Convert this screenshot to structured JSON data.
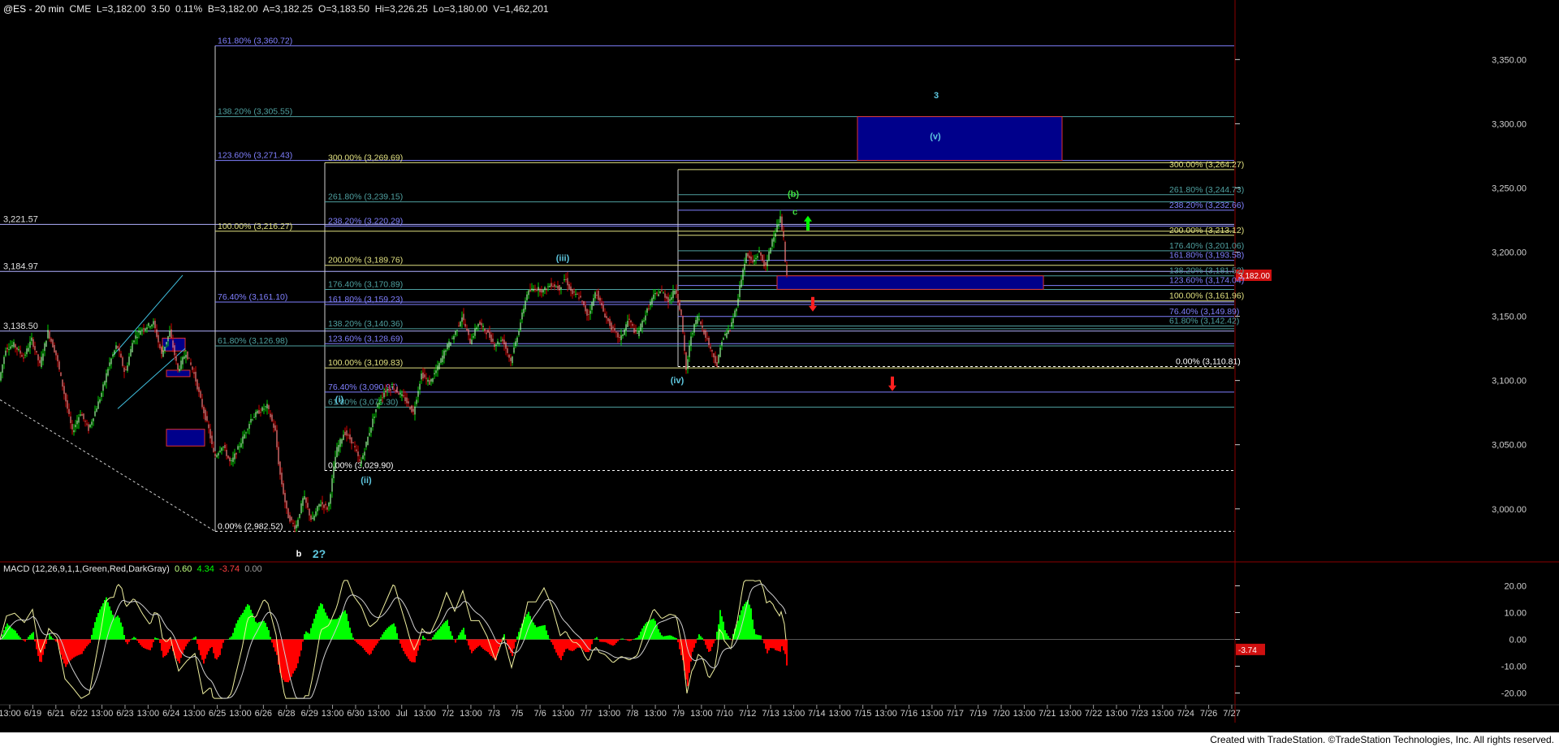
{
  "header": {
    "symbol": "@ES - 20 min",
    "exchange": "CME",
    "last": "L=3,182.00",
    "change": "3.50",
    "change_pct": "0.11%",
    "bid": "B=3,182.00",
    "ask": "A=3,182.25",
    "open": "O=3,183.50",
    "high": "Hi=3,226.25",
    "low": "Lo=3,180.00",
    "volume": "V=1,462,201"
  },
  "macd_header": {
    "title": "MACD (12,26,9,1,1,Green,Red,DarkGray)",
    "v1": "0.60",
    "v2": "4.34",
    "v3": "-3.74",
    "v4": "0.00"
  },
  "footer": "Created with TradeStation. ©TradeStation Technologies, Inc. All rights reserved.",
  "colors": {
    "background": "#000000",
    "price_axis_border": "#8b0000",
    "fib_blue": "#8080ff",
    "fib_teal": "#4fa0a0",
    "fib_yellow": "#e0e080",
    "target_box": "#00008b",
    "wave_label": "#5fc8e0",
    "up_arrow": "#00ff00",
    "down_arrow": "#ff2020",
    "macd_up": "#00ff00",
    "macd_down": "#ff0000"
  },
  "chart_data": {
    "type": "candlestick",
    "title": "@ES - 20 min",
    "ylim": [
      2960,
      3385
    ],
    "y_ticks": [
      "3,350.00",
      "3,300.00",
      "3,250.00",
      "3,200.00",
      "3,150.00",
      "3,100.00",
      "3,050.00",
      "3,000.00"
    ],
    "y_tick_values": [
      3350,
      3300,
      3250,
      3200,
      3150,
      3100,
      3050,
      3000
    ],
    "last_price_tag": "3,182.00",
    "last_price": 3182,
    "x_labels": [
      "13:00",
      "6/19",
      "6/21",
      "6/22",
      "13:00",
      "6/23",
      "13:00",
      "6/24",
      "13:00",
      "6/25",
      "13:00",
      "6/26",
      "6/28",
      "6/29",
      "13:00",
      "6/30",
      "13:00",
      "Jul",
      "13:00",
      "7/2",
      "13:00",
      "7/3",
      "7/5",
      "7/6",
      "13:00",
      "7/7",
      "13:00",
      "7/8",
      "13:00",
      "7/9",
      "13:00",
      "7/10",
      "7/12",
      "7/13",
      "13:00",
      "7/14",
      "13:00",
      "7/15",
      "13:00",
      "7/16",
      "13:00",
      "7/17",
      "7/19",
      "7/20",
      "13:00",
      "7/21",
      "13:00",
      "7/22",
      "13:00",
      "7/23",
      "13:00",
      "7/24",
      "7/26",
      "7/27"
    ],
    "price_path": [
      [
        0,
        3100
      ],
      [
        8,
        3125
      ],
      [
        18,
        3128
      ],
      [
        30,
        3118
      ],
      [
        40,
        3132
      ],
      [
        50,
        3112
      ],
      [
        60,
        3138
      ],
      [
        70,
        3120
      ],
      [
        80,
        3090
      ],
      [
        90,
        3060
      ],
      [
        100,
        3075
      ],
      [
        110,
        3062
      ],
      [
        125,
        3088
      ],
      [
        135,
        3112
      ],
      [
        145,
        3128
      ],
      [
        155,
        3105
      ],
      [
        165,
        3132
      ],
      [
        175,
        3140
      ],
      [
        190,
        3145
      ],
      [
        200,
        3120
      ],
      [
        210,
        3138
      ],
      [
        220,
        3108
      ],
      [
        230,
        3122
      ],
      [
        240,
        3105
      ],
      [
        250,
        3080
      ],
      [
        258,
        3062
      ],
      [
        265,
        3040
      ],
      [
        275,
        3050
      ],
      [
        285,
        3035
      ],
      [
        300,
        3055
      ],
      [
        310,
        3070
      ],
      [
        318,
        3075
      ],
      [
        330,
        3080
      ],
      [
        340,
        3060
      ],
      [
        345,
        3030
      ],
      [
        355,
        2995
      ],
      [
        365,
        2985
      ],
      [
        375,
        3010
      ],
      [
        385,
        2990
      ],
      [
        395,
        3005
      ],
      [
        405,
        3000
      ],
      [
        415,
        3045
      ],
      [
        425,
        3060
      ],
      [
        435,
        3052
      ],
      [
        445,
        3035
      ],
      [
        455,
        3058
      ],
      [
        465,
        3080
      ],
      [
        475,
        3092
      ],
      [
        485,
        3095
      ],
      [
        500,
        3085
      ],
      [
        510,
        3075
      ],
      [
        520,
        3105
      ],
      [
        530,
        3098
      ],
      [
        540,
        3110
      ],
      [
        550,
        3125
      ],
      [
        560,
        3135
      ],
      [
        570,
        3150
      ],
      [
        580,
        3130
      ],
      [
        590,
        3145
      ],
      [
        600,
        3138
      ],
      [
        610,
        3128
      ],
      [
        620,
        3132
      ],
      [
        630,
        3115
      ],
      [
        640,
        3140
      ],
      [
        650,
        3168
      ],
      [
        660,
        3172
      ],
      [
        670,
        3170
      ],
      [
        680,
        3175
      ],
      [
        690,
        3172
      ],
      [
        697,
        3180
      ],
      [
        705,
        3168
      ],
      [
        715,
        3165
      ],
      [
        725,
        3150
      ],
      [
        735,
        3170
      ],
      [
        745,
        3152
      ],
      [
        755,
        3140
      ],
      [
        765,
        3132
      ],
      [
        775,
        3148
      ],
      [
        785,
        3135
      ],
      [
        795,
        3150
      ],
      [
        805,
        3165
      ],
      [
        815,
        3170
      ],
      [
        825,
        3162
      ],
      [
        833,
        3172
      ],
      [
        840,
        3150
      ],
      [
        846,
        3108
      ],
      [
        852,
        3135
      ],
      [
        860,
        3150
      ],
      [
        868,
        3138
      ],
      [
        876,
        3125
      ],
      [
        884,
        3112
      ],
      [
        890,
        3132
      ],
      [
        900,
        3140
      ],
      [
        908,
        3158
      ],
      [
        914,
        3180
      ],
      [
        920,
        3198
      ],
      [
        928,
        3192
      ],
      [
        936,
        3200
      ],
      [
        944,
        3188
      ],
      [
        952,
        3210
      ],
      [
        958,
        3220
      ],
      [
        962,
        3226
      ],
      [
        966,
        3210
      ],
      [
        969,
        3182
      ]
    ],
    "fib_levels": [
      {
        "label": "161.80% (3,360.72)",
        "value": 3360.72,
        "x0": 265,
        "x1": 1520,
        "color": "#8080ff",
        "lx": 268
      },
      {
        "label": "138.20% (3,305.55)",
        "value": 3305.55,
        "x0": 265,
        "x1": 1520,
        "color": "#4fa0a0",
        "lx": 268
      },
      {
        "label": "123.60% (3,271.43)",
        "value": 3271.43,
        "x0": 265,
        "x1": 1520,
        "color": "#8080ff",
        "lx": 268
      },
      {
        "label": "100.00% (3,216.27)",
        "value": 3216.27,
        "x0": 265,
        "x1": 1520,
        "color": "#e0e080",
        "lx": 268
      },
      {
        "label": "76.40% (3,161.10)",
        "value": 3161.1,
        "x0": 265,
        "x1": 1520,
        "color": "#8080ff",
        "lx": 268
      },
      {
        "label": "61.80% (3,126.98)",
        "value": 3126.98,
        "x0": 265,
        "x1": 1520,
        "color": "#4fa0a0",
        "lx": 268
      },
      {
        "label": "0.00% (2,982.52)",
        "value": 2982.52,
        "x0": 265,
        "x1": 1520,
        "color": "#ffffff",
        "lx": 268,
        "dashed": true
      },
      {
        "label": "300.00% (3,269.69)",
        "value": 3269.69,
        "x0": 400,
        "x1": 1520,
        "color": "#e0e080",
        "lx": 404
      },
      {
        "label": "261.80% (3,239.15)",
        "value": 3239.15,
        "x0": 400,
        "x1": 1520,
        "color": "#4fa0a0",
        "lx": 404
      },
      {
        "label": "238.20% (3,220.29)",
        "value": 3220.29,
        "x0": 400,
        "x1": 1520,
        "color": "#8080ff",
        "lx": 404
      },
      {
        "label": "200.00% (3,189.76)",
        "value": 3189.76,
        "x0": 400,
        "x1": 1520,
        "color": "#e0e080",
        "lx": 404
      },
      {
        "label": "176.40% (3,170.89)",
        "value": 3170.89,
        "x0": 400,
        "x1": 1520,
        "color": "#4fa0a0",
        "lx": 404
      },
      {
        "label": "161.80% (3,159.23)",
        "value": 3159.23,
        "x0": 400,
        "x1": 1520,
        "color": "#8080ff",
        "lx": 404
      },
      {
        "label": "138.20% (3,140.36)",
        "value": 3140.36,
        "x0": 400,
        "x1": 1520,
        "color": "#4fa0a0",
        "lx": 404
      },
      {
        "label": "123.60% (3,128.69)",
        "value": 3128.69,
        "x0": 400,
        "x1": 1520,
        "color": "#8080ff",
        "lx": 404
      },
      {
        "label": "100.00% (3,109.83)",
        "value": 3109.83,
        "x0": 400,
        "x1": 1520,
        "color": "#e0e080",
        "lx": 404
      },
      {
        "label": "76.40% (3,090.97)",
        "value": 3090.97,
        "x0": 400,
        "x1": 1520,
        "color": "#8080ff",
        "lx": 404
      },
      {
        "label": "61.80% (3,079.30)",
        "value": 3079.3,
        "x0": 400,
        "x1": 1520,
        "color": "#4fa0a0",
        "lx": 404
      },
      {
        "label": "0.00% (3,029.90)",
        "value": 3029.9,
        "x0": 400,
        "x1": 1520,
        "color": "#ffffff",
        "lx": 404,
        "dashed": true
      },
      {
        "label": "300.00% (3,264.27)",
        "value": 3264.27,
        "x0": 835,
        "x1": 1520,
        "color": "#e0e080",
        "lx": 1440
      },
      {
        "label": "261.80% (3,244.73)",
        "value": 3244.73,
        "x0": 835,
        "x1": 1520,
        "color": "#4fa0a0",
        "lx": 1440
      },
      {
        "label": "238.20% (3,232.66)",
        "value": 3232.66,
        "x0": 835,
        "x1": 1520,
        "color": "#8080ff",
        "lx": 1440
      },
      {
        "label": "200.00% (3,213.12)",
        "value": 3213.12,
        "x0": 835,
        "x1": 1520,
        "color": "#e0e080",
        "lx": 1440
      },
      {
        "label": "176.40% (3,201.06)",
        "value": 3201.06,
        "x0": 835,
        "x1": 1520,
        "color": "#4fa0a0",
        "lx": 1440
      },
      {
        "label": "161.80% (3,193.58)",
        "value": 3193.58,
        "x0": 835,
        "x1": 1520,
        "color": "#8080ff",
        "lx": 1440
      },
      {
        "label": "138.20% (3,181.52)",
        "value": 3181.52,
        "x0": 835,
        "x1": 1520,
        "color": "#4fa0a0",
        "lx": 1440
      },
      {
        "label": "123.60% (3,174.04)",
        "value": 3174.04,
        "x0": 835,
        "x1": 1520,
        "color": "#8080ff",
        "lx": 1440
      },
      {
        "label": "100.00% (3,161.96)",
        "value": 3161.96,
        "x0": 835,
        "x1": 1520,
        "color": "#e0e080",
        "lx": 1440
      },
      {
        "label": "76.40% (3,149.89)",
        "value": 3149.89,
        "x0": 835,
        "x1": 1520,
        "color": "#8080ff",
        "lx": 1440
      },
      {
        "label": "61.80% (3,142.42)",
        "value": 3142.42,
        "x0": 835,
        "x1": 1520,
        "color": "#4fa0a0",
        "lx": 1440
      },
      {
        "label": "0.00% (3,110.81)",
        "value": 3110.81,
        "x0": 835,
        "x1": 1520,
        "color": "#ffffff",
        "lx": 1448,
        "dashed": true
      }
    ],
    "horizontal_levels": [
      {
        "label": "3,221.57",
        "value": 3221.57
      },
      {
        "label": "3,184.97",
        "value": 3184.97
      },
      {
        "label": "3,138.50",
        "value": 3138.5
      }
    ],
    "wave_labels": [
      {
        "text": "(i)",
        "x": 418,
        "price": 3083,
        "color": "#5fc8e0"
      },
      {
        "text": "(ii)",
        "x": 451,
        "price": 3020,
        "color": "#5fc8e0"
      },
      {
        "text": "(iii)",
        "x": 693,
        "price": 3193,
        "color": "#5fc8e0"
      },
      {
        "text": "(iv)",
        "x": 834,
        "price": 3098,
        "color": "#5fc8e0"
      },
      {
        "text": "(v)",
        "x": 1152,
        "price": 3288,
        "color": "#5fc8e0"
      },
      {
        "text": "3",
        "x": 1153,
        "price": 3320,
        "color": "#5fc8e0"
      },
      {
        "text": "(b)",
        "x": 977,
        "price": 3243,
        "color": "#40e040"
      },
      {
        "text": "c",
        "x": 979,
        "price": 3229,
        "color": "#40e040"
      },
      {
        "text": "b",
        "x": 368,
        "price": 2963,
        "color": "#ffffff"
      },
      {
        "text": "2?",
        "x": 393,
        "price": 2962,
        "color": "#5fc8e0"
      }
    ],
    "target_boxes": [
      {
        "x0": 1056,
        "x1": 1308,
        "p_top": 3305.55,
        "p_bot": 3271.43
      },
      {
        "x0": 957,
        "x1": 1285,
        "p_top": 3181.52,
        "p_bot": 3171.0
      },
      {
        "x0": 200,
        "x1": 228,
        "p_top": 3133,
        "p_bot": 3123
      },
      {
        "x0": 205,
        "x1": 234,
        "p_top": 3108,
        "p_bot": 3103
      },
      {
        "x0": 205,
        "x1": 252,
        "p_top": 3062,
        "p_bot": 3049
      }
    ],
    "arrows": [
      {
        "dir": "up",
        "x": 995,
        "price": 3222,
        "color": "#00ff00"
      },
      {
        "dir": "down",
        "x": 1001,
        "price": 3160,
        "color": "#ff2020"
      },
      {
        "dir": "down",
        "x": 1099,
        "price": 3098,
        "color": "#ff2020"
      }
    ],
    "channel": [
      {
        "x0": 140,
        "y0": 3120,
        "x1": 225,
        "y1": 3182
      },
      {
        "x0": 145,
        "y0": 3078,
        "x1": 228,
        "y1": 3125
      }
    ],
    "macd": {
      "ylim": [
        -25,
        25
      ],
      "y_ticks": [
        "20.00",
        "10.00",
        "0.00",
        "-10.00",
        "-20.00"
      ],
      "y_tick_values": [
        20,
        10,
        0,
        -10,
        -20
      ],
      "last_value_tag": "-3.74",
      "last_value": -3.74
    }
  }
}
